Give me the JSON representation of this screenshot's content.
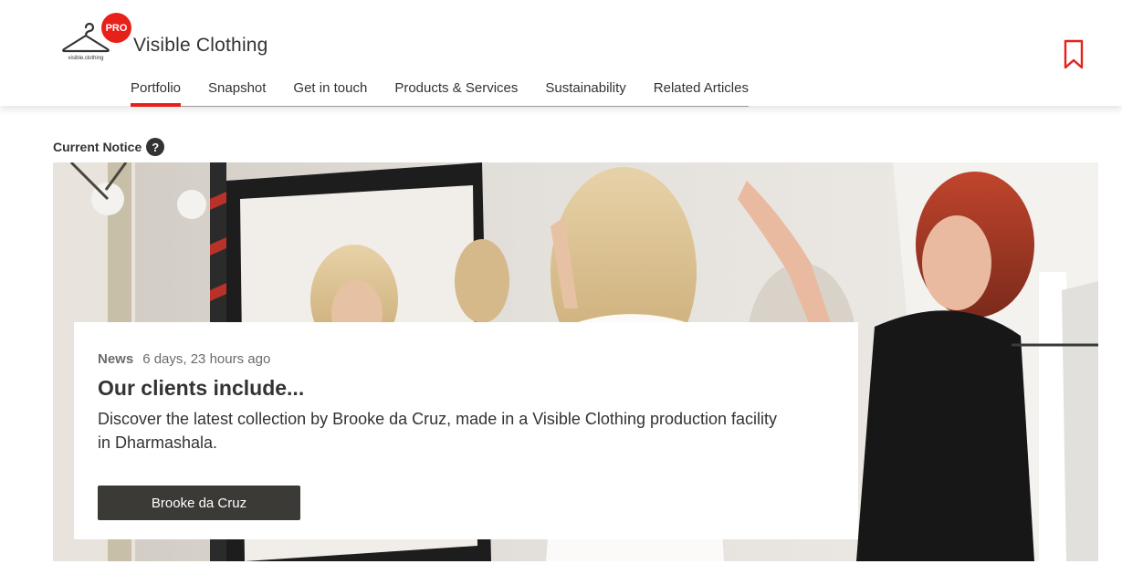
{
  "brand": {
    "name": "Visible Clothing",
    "logo_text": "visible.clothing",
    "badge": "PRO",
    "accent_color": "#e8201a"
  },
  "header": {
    "bookmark_icon": "bookmark-icon"
  },
  "nav": {
    "items": [
      {
        "label": "Portfolio",
        "active": true
      },
      {
        "label": "Snapshot",
        "active": false
      },
      {
        "label": "Get in touch",
        "active": false
      },
      {
        "label": "Products & Services",
        "active": false
      },
      {
        "label": "Sustainability",
        "active": false
      },
      {
        "label": "Related Articles",
        "active": false
      }
    ]
  },
  "notice": {
    "title": "Current Notice",
    "help_icon": "?"
  },
  "card": {
    "category": "News",
    "time": "6 days, 23 hours ago",
    "title": "Our clients include...",
    "description": "Discover the latest collection by Brooke da Cruz, made in a Visible Clothing production facility in Dharmashala.",
    "button_label": "Brooke da Cruz"
  }
}
